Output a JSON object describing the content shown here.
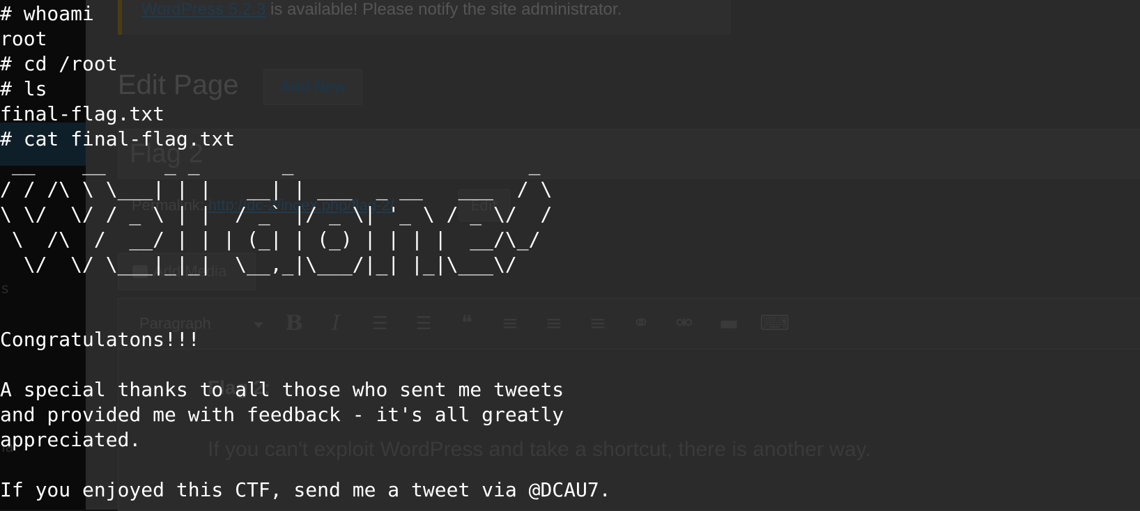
{
  "wordpress": {
    "sidebar": {
      "fragment_1": "s",
      "fragment_2": "ia"
    },
    "notice": {
      "link_text": "WordPress 5.2.3",
      "text": " is available! Please notify the site administrator."
    },
    "page_title": "Edit Page",
    "add_new_label": "Add New",
    "post_title": "Flag 2",
    "permalink": {
      "label": "Permalink: ",
      "url": "http://dc-2/index.php/flag-2/",
      "edit_label": "Edit"
    },
    "add_media_label": "Add Media",
    "toolbar": {
      "format_select": "Paragraph",
      "bold": "B",
      "italic": "I",
      "bulleted_list": "☰",
      "numbered_list": "☰",
      "blockquote": "❝",
      "align_left": "≡",
      "align_center": "≡",
      "align_right": "≡",
      "insert_link": "⚭",
      "remove_link": "⚮",
      "read_more": "▬",
      "toolbar_toggle": "⌨"
    },
    "content": {
      "heading": "Flag 2:",
      "paragraph": "If you can't exploit WordPress and take a shortcut, there is another way."
    }
  },
  "terminal": {
    "lines": [
      "# whoami",
      "root",
      "# cd /root",
      "# ls",
      "final-flag.txt",
      "# cat final-flag.txt",
      " __    __     _ _       _                    _ ",
      "/ / /\\ \\ \\___| | |   __| | ___  _ __   ___  / \\",
      "\\ \\/  \\/ / _ \\ | |  / _` |/ _ \\| '_ \\ / _ \\/  /",
      " \\  /\\  /  __/ | | | (_| | (_) | | | |  __/\\_/ ",
      "  \\/  \\/ \\___|_|_|  \\__,_|\\___/|_| |_|\\___\\/   ",
      "",
      "",
      "Congratulatons!!!",
      "",
      "A special thanks to all those who sent me tweets",
      "and provided me with feedback - it's all greatly",
      "appreciated.",
      "",
      "If you enjoyed this CTF, send me a tweet via @DCAU7."
    ]
  }
}
